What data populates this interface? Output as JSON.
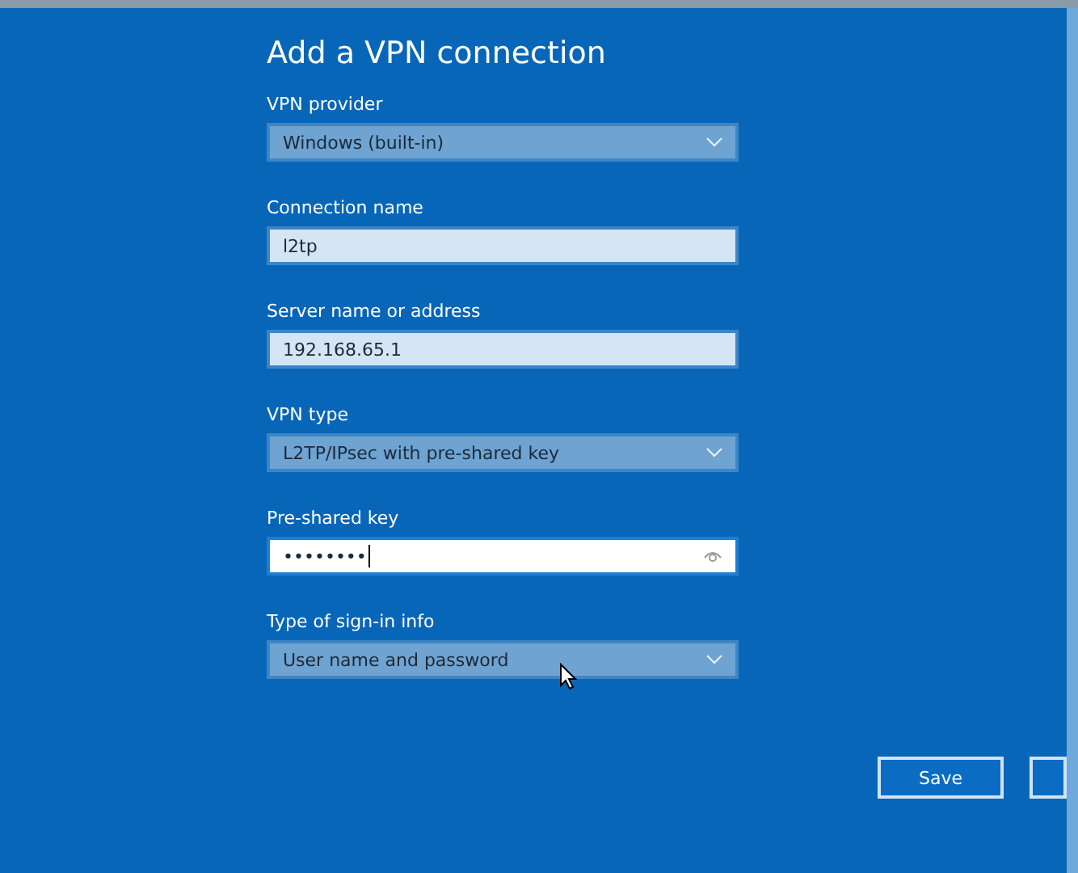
{
  "title": "Add a VPN connection",
  "fields": [
    {
      "label": "VPN provider",
      "kind": "dropdown",
      "value": "Windows (built-in)",
      "focused": false
    },
    {
      "label": "Connection name",
      "kind": "text",
      "value": "l2tp",
      "focused": false
    },
    {
      "label": "Server name or address",
      "kind": "text",
      "value": "192.168.65.1",
      "focused": false
    },
    {
      "label": "VPN type",
      "kind": "dropdown",
      "value": "L2TP/IPsec with pre-shared key",
      "focused": false
    },
    {
      "label": "Pre-shared key",
      "kind": "password",
      "value": "••••••••",
      "focused": true
    },
    {
      "label": "Type of sign-in info",
      "kind": "dropdown",
      "value": "User name and password",
      "focused": false
    }
  ],
  "buttons": [
    {
      "label": "Save"
    }
  ]
}
